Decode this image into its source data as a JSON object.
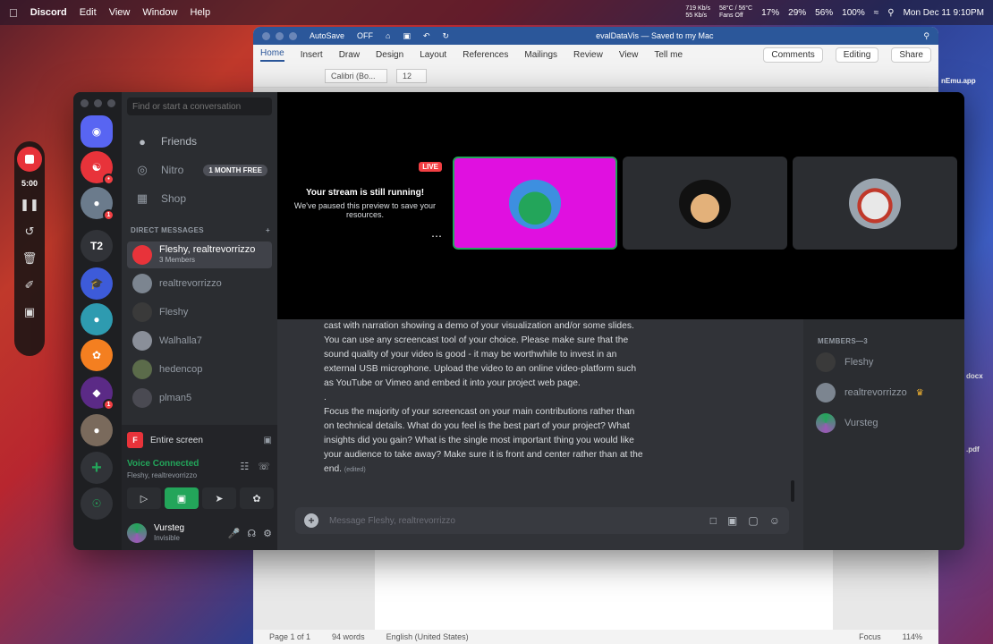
{
  "menubar": {
    "app": "Discord",
    "items": [
      "Edit",
      "View",
      "Window",
      "Help"
    ],
    "net_up": "719 Kb/s",
    "net_down": "55 Kb/s",
    "temps": "58°C / 56°C",
    "fans": "Fans Off",
    "cpu": "17%",
    "mem": "29%",
    "disk": "56%",
    "battery": "100%",
    "datetime": "Mon Dec 11  9:10PM"
  },
  "word": {
    "autosave": "AutoSave",
    "autosave_state": "OFF",
    "doc_title": "evalDataVis — Saved to my Mac",
    "tabs": [
      "Home",
      "Insert",
      "Draw",
      "Design",
      "Layout",
      "References",
      "Mailings",
      "Review",
      "View"
    ],
    "tell_me": "Tell me",
    "comments": "Comments",
    "editing": "Editing",
    "share": "Share",
    "font": "Calibri (Bo...",
    "font_size": "12",
    "status_page": "Page 1 of 1",
    "status_words": "94 words",
    "status_lang": "English (United States)",
    "status_focus": "Focus",
    "status_zoom": "114%"
  },
  "right_app": {
    "label1": "nEmu.app",
    "label2": "docx",
    "label3": ".pdf"
  },
  "recorder": {
    "time": "5:00"
  },
  "discord": {
    "search_placeholder": "Find or start a conversation",
    "nav": {
      "friends": "Friends",
      "nitro": "Nitro",
      "nitro_badge": "1 MONTH FREE",
      "shop": "Shop"
    },
    "direct_messages_header": "DIRECT MESSAGES",
    "dms": [
      {
        "name": "Fleshy, realtrevorrizzo",
        "sub": "3 Members"
      },
      {
        "name": "realtrevorrizzo"
      },
      {
        "name": "Fleshy"
      },
      {
        "name": "Walhalla7"
      },
      {
        "name": "hedencop"
      },
      {
        "name": "plman5"
      }
    ],
    "guild_t2": "T2",
    "voice": {
      "screen_label": "Entire screen",
      "connected": "Voice Connected",
      "channel": "Fleshy, realtrevorrizzo"
    },
    "user": {
      "name": "Vursteg",
      "status": "Invisible"
    },
    "stream": {
      "live_badge": "LIVE",
      "title": "Your stream is still running!",
      "desc": "We've paused this preview to save your resources."
    },
    "message": {
      "p1": "cast with narration showing a demo of your visualization and/or some slides. You can use any screencast tool of your choice. Please make sure that the sound quality of your video is good - it may be worthwhile to invest in an external USB microphone. Upload the video to an online video-platform such as YouTube or Vimeo and embed it into your project web page.",
      "p2": ".",
      "p3": "Focus the majority of your screencast on your main contributions rather than on technical details. What do you feel is the best part of your project? What insights did you gain? What is the single most important thing you would like your audience to take away? Make sure it is front and center rather than at the end.",
      "edited": "(edited)"
    },
    "composer_placeholder": "Message Fleshy, realtrevorrizzo",
    "members_header": "MEMBERS—3",
    "members": [
      "Fleshy",
      "realtrevorrizzo",
      "Vursteg"
    ]
  },
  "colors": {
    "discord_bg": "#313338",
    "sidebar_bg": "#2b2d31",
    "guild_bg": "#1e1f22",
    "accent_green": "#23a55a",
    "live_red": "#f23f43",
    "blurple": "#5865f2"
  }
}
